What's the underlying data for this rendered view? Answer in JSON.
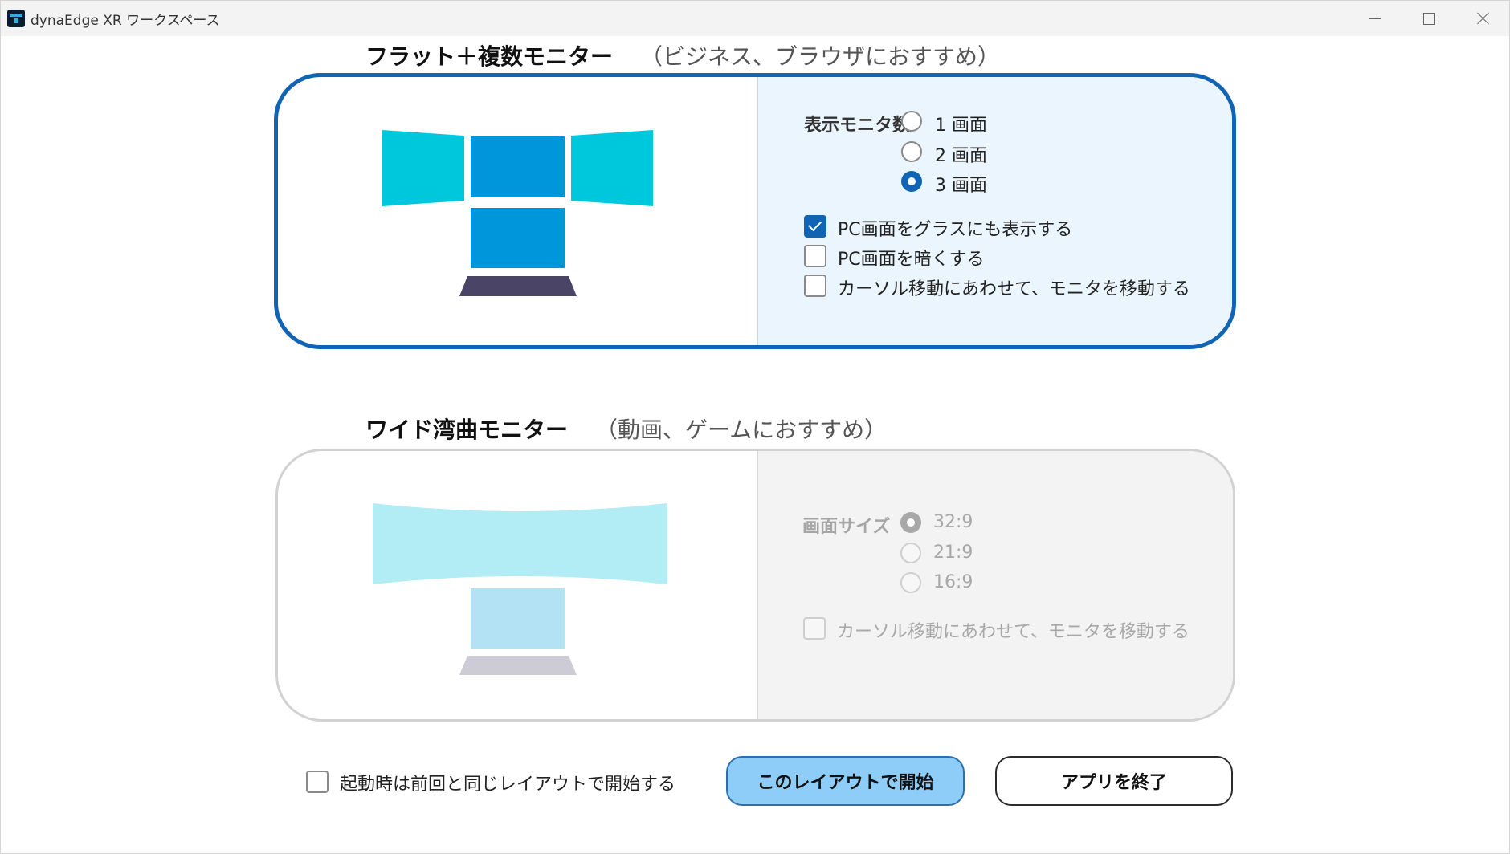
{
  "window": {
    "title": "dynaEdge XR ワークスペース",
    "icon": "app-logo-icon"
  },
  "flat_section": {
    "title": "フラット＋複数モニター",
    "subtitle": "（ビジネス、ブラウザにおすすめ）",
    "selected": true,
    "monitor_count_label": "表示モニタ数",
    "monitor_options": [
      {
        "label": "1 画面",
        "checked": false
      },
      {
        "label": "2 画面",
        "checked": false
      },
      {
        "label": "3 画面",
        "checked": true
      }
    ],
    "checkboxes": [
      {
        "label": "PC画面をグラスにも表示する",
        "checked": true
      },
      {
        "label": "PC画面を暗くする",
        "checked": false
      },
      {
        "label": "カーソル移動にあわせて、モニタを移動する",
        "checked": false
      }
    ]
  },
  "wide_section": {
    "title": "ワイド湾曲モニター",
    "subtitle": "（動画、ゲームにおすすめ）",
    "selected": false,
    "size_label": "画面サイズ",
    "size_options": [
      {
        "label": "32:9",
        "checked": true
      },
      {
        "label": "21:9",
        "checked": false
      },
      {
        "label": "16:9",
        "checked": false
      }
    ],
    "checkboxes": [
      {
        "label": "カーソル移動にあわせて、モニタを移動する",
        "checked": false
      }
    ]
  },
  "footer": {
    "remember_layout_label": "起動時は前回と同じレイアウトで開始する",
    "remember_layout_checked": false,
    "start_button": "このレイアウトで開始",
    "exit_button": "アプリを終了"
  },
  "colors": {
    "accent": "#1164b4",
    "start_button_bg": "#8ecdf7",
    "selected_panel_bg": "#ebf5fd",
    "monitor_side": "#00c8dc",
    "monitor_center": "#0096dc",
    "laptop_base": "#4a4566"
  }
}
